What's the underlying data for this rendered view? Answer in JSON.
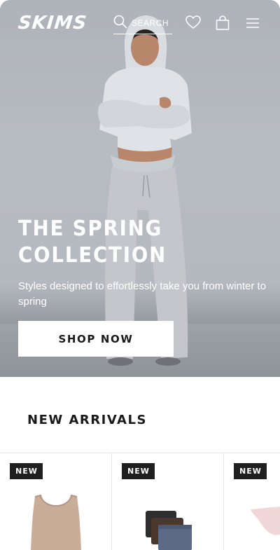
{
  "header": {
    "logo": "SKIMS",
    "search_label": "SEARCH",
    "icons": [
      "search-icon",
      "heart-icon",
      "bag-icon",
      "menu-icon"
    ]
  },
  "hero": {
    "title": "THE SPRING COLLECTION",
    "subtitle": "Styles designed to effortlessly take you from winter to spring",
    "cta_label": "SHOP NOW"
  },
  "new_arrivals": {
    "title": "NEW ARRIVALS",
    "products": [
      {
        "badge": "NEW",
        "image": "tank-bra-top",
        "color": "#c9ad98"
      },
      {
        "badge": "NEW",
        "image": "boxer-briefs-3pack",
        "colors": [
          "#2e2e2e",
          "#4b382c",
          "#5d6a86"
        ]
      },
      {
        "badge": "NEW",
        "image": "brief",
        "color": "#f2d7d9"
      }
    ]
  },
  "colors": {
    "badge_bg": "#1f1f1f",
    "button_bg": "#ffffff",
    "text_dark": "#1a1a1a"
  }
}
